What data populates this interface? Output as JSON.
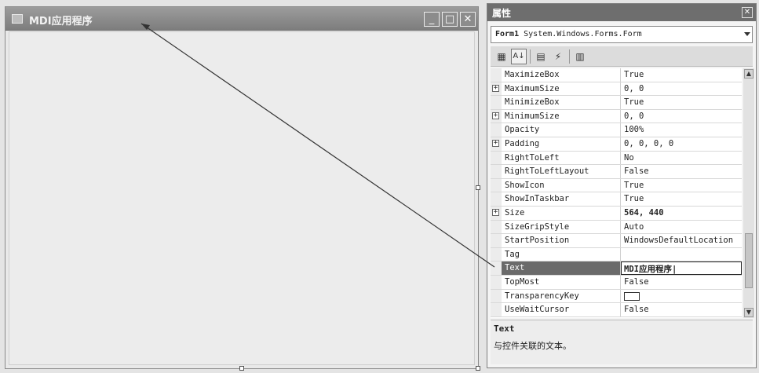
{
  "form": {
    "title": "MDI应用程序",
    "min_glyph": "_",
    "max_glyph": "□",
    "close_glyph": "✕"
  },
  "properties": {
    "title": "属性",
    "close_glyph": "✕",
    "object_name": "Form1",
    "object_type": "System.Windows.Forms.Form",
    "toolbar": {
      "categorized": "▦",
      "alphabetical": "A↓",
      "properties": "▤",
      "events": "⚡",
      "pages": "▥"
    },
    "rows": [
      {
        "name": "MaximizeBox",
        "value": "True",
        "expandable": false
      },
      {
        "name": "MaximumSize",
        "value": "0, 0",
        "expandable": true
      },
      {
        "name": "MinimizeBox",
        "value": "True",
        "expandable": false
      },
      {
        "name": "MinimumSize",
        "value": "0, 0",
        "expandable": true
      },
      {
        "name": "Opacity",
        "value": "100%",
        "expandable": false
      },
      {
        "name": "Padding",
        "value": "0, 0, 0, 0",
        "expandable": true
      },
      {
        "name": "RightToLeft",
        "value": "No",
        "expandable": false
      },
      {
        "name": "RightToLeftLayout",
        "value": "False",
        "expandable": false
      },
      {
        "name": "ShowIcon",
        "value": "True",
        "expandable": false
      },
      {
        "name": "ShowInTaskbar",
        "value": "True",
        "expandable": false
      },
      {
        "name": "Size",
        "value": "564, 440",
        "expandable": true,
        "bold": true
      },
      {
        "name": "SizeGripStyle",
        "value": "Auto",
        "expandable": false
      },
      {
        "name": "StartPosition",
        "value": "WindowsDefaultLocation",
        "expandable": false
      },
      {
        "name": "Tag",
        "value": "",
        "expandable": false
      },
      {
        "name": "Text",
        "value": "MDI应用程序|",
        "expandable": false,
        "selected": true,
        "bold": true
      },
      {
        "name": "TopMost",
        "value": "False",
        "expandable": false
      },
      {
        "name": "TransparencyKey",
        "value": "",
        "expandable": false,
        "swatch": true
      },
      {
        "name": "UseWaitCursor",
        "value": "False",
        "expandable": false
      }
    ],
    "scroll_up": "▲",
    "scroll_down": "▼",
    "description": {
      "title": "Text",
      "text": "与控件关联的文本。"
    }
  }
}
